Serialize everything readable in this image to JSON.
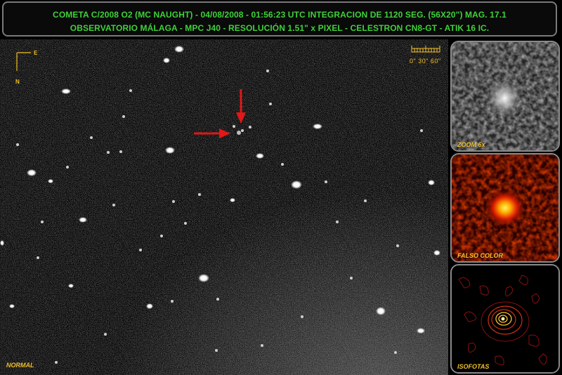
{
  "header": {
    "line1": "COMETA C/2008 O2 (MC NAUGHT) - 04/08/2008 - 01:56:23 UTC  INTEGRACION DE 1120 SEG. (56X20\") MAG. 17.1",
    "line2": "OBSERVATORIO MÁLAGA  - MPC J40 - RESOLUCIÓN 1.51\" x PIXEL - CELESTRON CN8-GT - ATIK 16 IC."
  },
  "main": {
    "mode_label": "NORMAL",
    "scale_label": "0\"  30\"  60\"",
    "compass": {
      "north": "N",
      "east": "E"
    }
  },
  "panels": [
    {
      "label": "ZOOM 6x"
    },
    {
      "label": "FALSO COLOR"
    },
    {
      "label": "ISOFOTAS"
    }
  ],
  "colors": {
    "title_text": "#3fd13a",
    "annotation": "#f3c12b",
    "arrow": "#e01818"
  }
}
